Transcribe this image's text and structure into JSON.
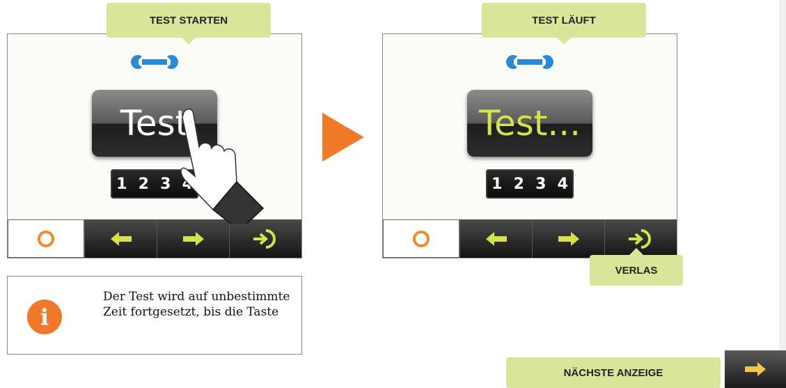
{
  "screen1": {
    "callout": "TEST STARTEN",
    "button_label": "Test",
    "numbers": [
      "1",
      "2",
      "3",
      "4"
    ]
  },
  "screen2": {
    "callout": "TEST LÄUFT",
    "button_label": "Test...",
    "numbers": [
      "1",
      "2",
      "3",
      "4"
    ],
    "exit_callout": "VERLAS"
  },
  "info": {
    "icon": "i",
    "text": "Der Test wird auf unbestimmte Zeit fortgesetzt, bis die Taste"
  },
  "footer": {
    "next_label": "NÄCHSTE ANZEIGE"
  },
  "colors": {
    "callout": "#d9e69a",
    "accent_orange": "#f08a2c",
    "arrow_yellow": "#d6e24a"
  },
  "icons": [
    "wrench-icon",
    "hand-pointer-icon",
    "home-icon",
    "arrow-left-icon",
    "arrow-right-icon",
    "exit-icon",
    "info-icon",
    "play-icon"
  ]
}
